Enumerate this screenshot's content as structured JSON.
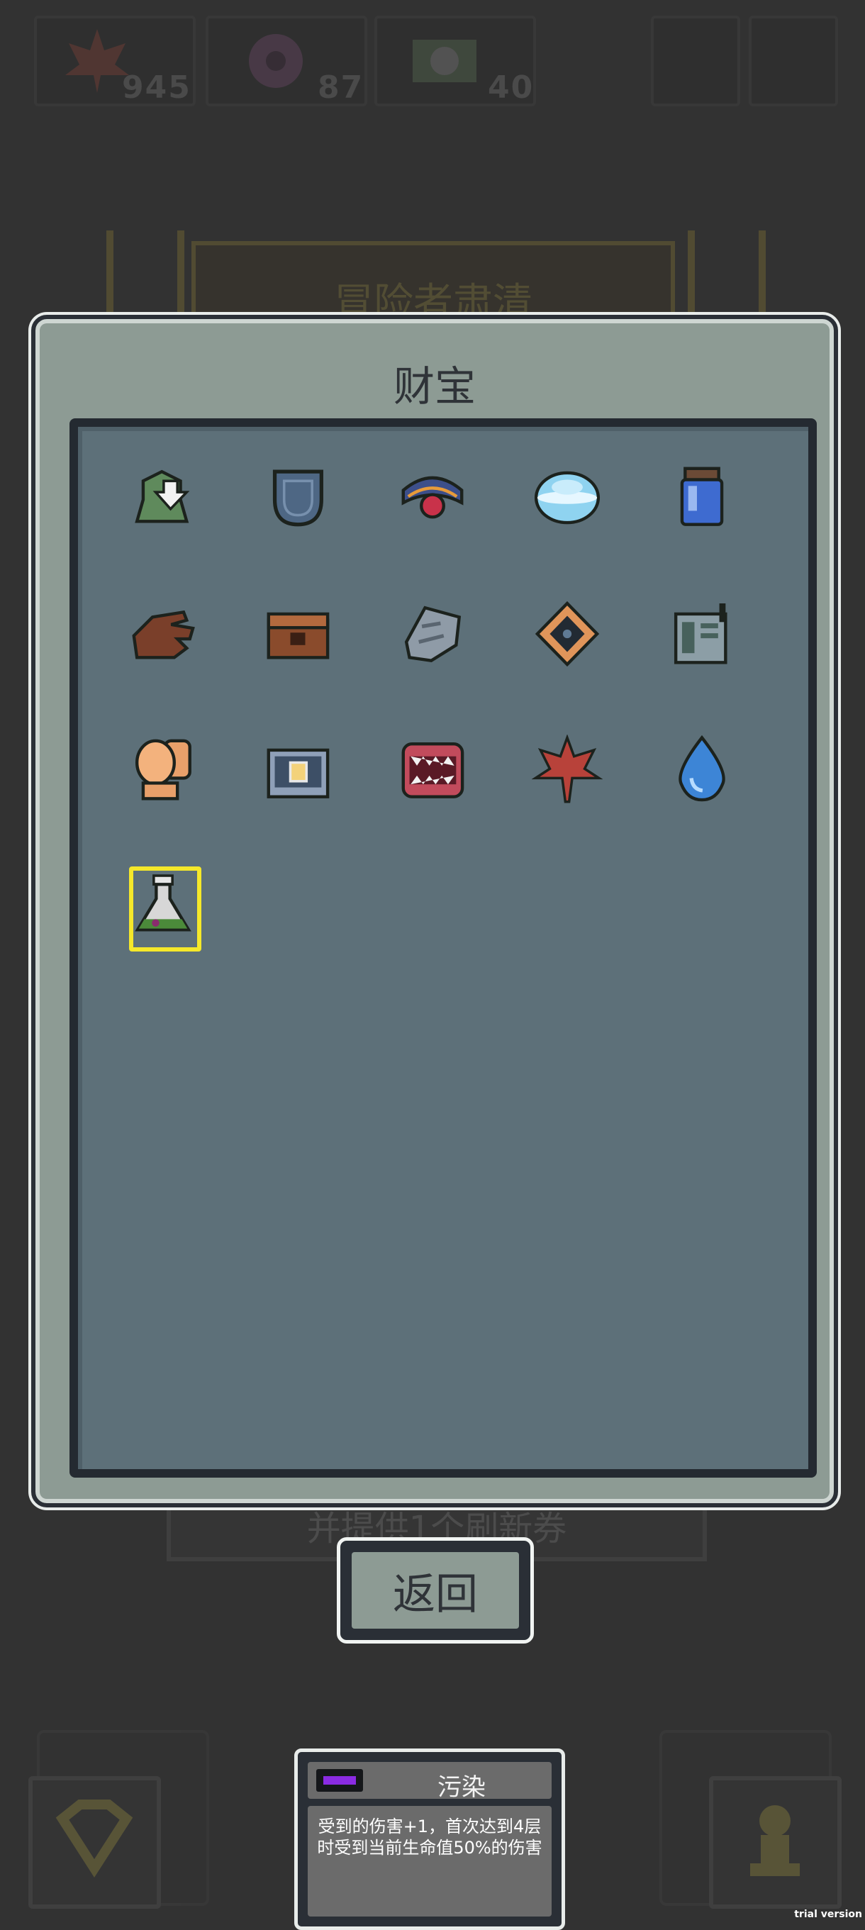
{
  "hud": {
    "resource_1_value": "945",
    "resource_2_value": "87",
    "resource_3_value": "40"
  },
  "background": {
    "banner_title": "冒险者肃清",
    "bottom_strip_text": "并提供1个刷新券"
  },
  "panel": {
    "title": "财宝",
    "items": [
      {
        "icon": "green-hooded-figure-icon"
      },
      {
        "icon": "blue-pocket-icon"
      },
      {
        "icon": "red-orb-relic-icon"
      },
      {
        "icon": "cyan-ufo-disc-icon"
      },
      {
        "icon": "blue-potion-jar-icon"
      },
      {
        "icon": "brown-glove-icon"
      },
      {
        "icon": "wooden-chest-icon"
      },
      {
        "icon": "steel-rock-icon"
      },
      {
        "icon": "diamond-eye-sigil-icon"
      },
      {
        "icon": "radio-device-icon"
      },
      {
        "icon": "orange-toilet-icon"
      },
      {
        "icon": "camera-box-icon"
      },
      {
        "icon": "mimic-mouth-icon"
      },
      {
        "icon": "maple-leaf-icon"
      },
      {
        "icon": "water-drop-icon"
      },
      {
        "icon": "poison-flask-icon",
        "selected": true
      }
    ]
  },
  "return_button": {
    "label": "返回"
  },
  "tooltip": {
    "title": "污染",
    "description": "受到的伤害+1，首次达到4层时受到当前生命值50%的伤害",
    "swatch_color": "#8a2be2"
  },
  "watermark": "trial version"
}
